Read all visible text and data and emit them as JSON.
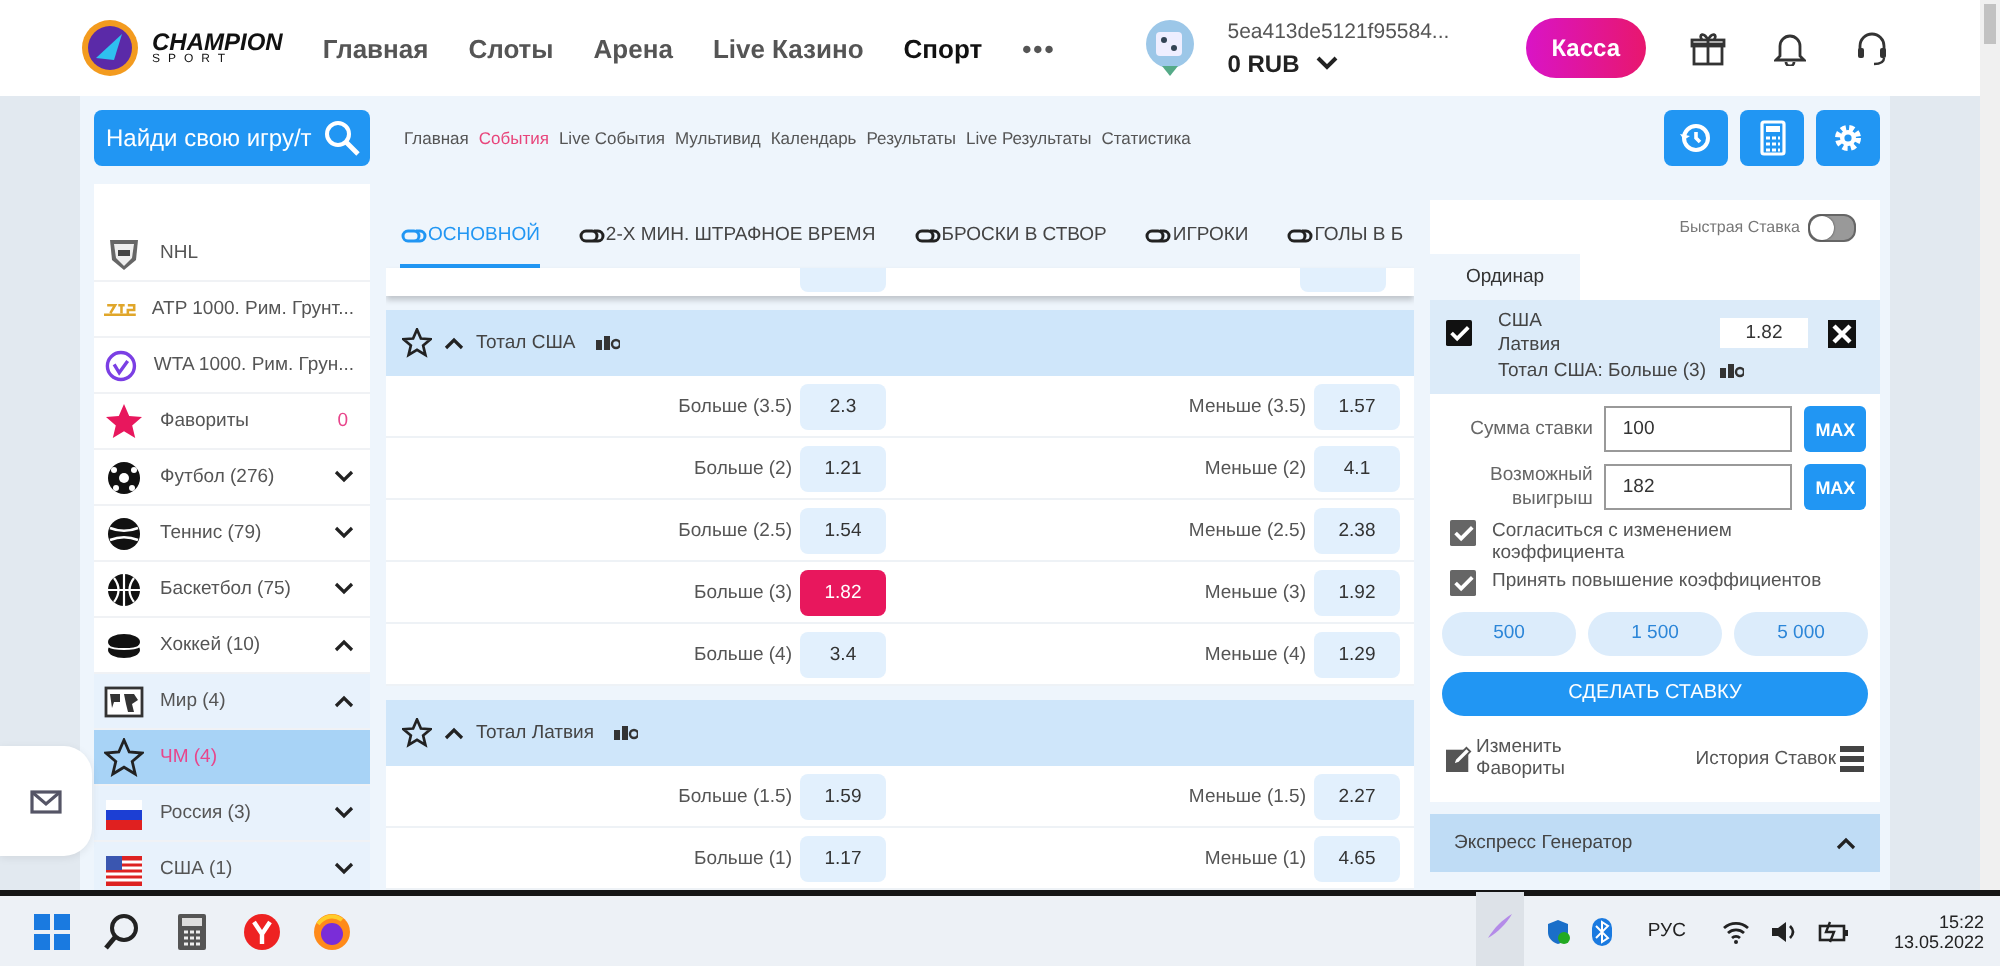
{
  "header": {
    "logo": {
      "title": "CHAMPION",
      "subtitle": "SPORT"
    },
    "nav": [
      {
        "label": "Главная",
        "selected": false
      },
      {
        "label": "Слоты",
        "selected": false
      },
      {
        "label": "Арена",
        "selected": false
      },
      {
        "label": "Live Казино",
        "selected": false
      },
      {
        "label": "Спорт",
        "selected": true
      }
    ],
    "more": "•••",
    "account": {
      "user_id": "5ea413de5121f95584...",
      "balance": "0 RUB"
    },
    "cashier_button": "Касса"
  },
  "subbar": {
    "search": {
      "placeholder": "Найди свою игру/т"
    },
    "breadcrumbs": [
      {
        "label": "Главная",
        "selected": false
      },
      {
        "label": "События",
        "selected": true
      },
      {
        "label": "Live События",
        "selected": false
      },
      {
        "label": "Мультивид",
        "selected": false
      },
      {
        "label": "Календарь",
        "selected": false
      },
      {
        "label": "Результаты",
        "selected": false
      },
      {
        "label": "Live Результаты",
        "selected": false
      },
      {
        "label": "Статистика",
        "selected": false
      }
    ]
  },
  "sidebar": {
    "items": [
      {
        "kind": "nhl",
        "label": "NHL",
        "selected": false
      },
      {
        "kind": "atp",
        "label": "ATP 1000. Рим. Грунт...",
        "selected": false
      },
      {
        "kind": "wta",
        "label": "WTA 1000. Рим. Грун...",
        "selected": false
      },
      {
        "kind": "favorites",
        "label": "Фавориты",
        "count": "0",
        "selected": false
      },
      {
        "kind": "football",
        "label": "Футбол (276)",
        "selected": false,
        "expanded": false
      },
      {
        "kind": "tennis",
        "label": "Теннис (79)",
        "selected": false,
        "expanded": false
      },
      {
        "kind": "basketball",
        "label": "Баскетбол (75)",
        "selected": false,
        "expanded": false
      },
      {
        "kind": "hockey",
        "label": "Хоккей (10)",
        "selected": false,
        "expanded": true,
        "children": [
          {
            "kind": "world",
            "label": "Мир (4)",
            "selected": false,
            "expanded": true,
            "children": [
              {
                "kind": "tournament",
                "label": "ЧМ (4)",
                "selected": true
              }
            ]
          },
          {
            "kind": "flag-ru",
            "label": "Россия (3)",
            "selected": false,
            "expanded": false
          },
          {
            "kind": "flag-us",
            "label": "США (1)",
            "selected": false,
            "expanded": false
          }
        ]
      }
    ]
  },
  "market_tabs": [
    {
      "label": "ОСНОВНОЙ",
      "selected": true
    },
    {
      "label": "2-Х МИН. ШТРАФНОЕ ВРЕМЯ",
      "selected": false
    },
    {
      "label": "БРОСКИ В СТВОР",
      "selected": false
    },
    {
      "label": "ИГРОКИ",
      "selected": false
    },
    {
      "label": "ГОЛЫ В Б",
      "selected": false
    }
  ],
  "markets": [
    {
      "title": "Тотал США",
      "favorite": false,
      "expanded": true,
      "rows": [
        {
          "left": {
            "label": "Больше (3.5)",
            "odds": "2.3",
            "selected": false
          },
          "right": {
            "label": "Меньше (3.5)",
            "odds": "1.57",
            "selected": false
          }
        },
        {
          "left": {
            "label": "Больше (2)",
            "odds": "1.21",
            "selected": false
          },
          "right": {
            "label": "Меньше (2)",
            "odds": "4.1",
            "selected": false
          }
        },
        {
          "left": {
            "label": "Больше (2.5)",
            "odds": "1.54",
            "selected": false
          },
          "right": {
            "label": "Меньше (2.5)",
            "odds": "2.38",
            "selected": false
          }
        },
        {
          "left": {
            "label": "Больше (3)",
            "odds": "1.82",
            "selected": true
          },
          "right": {
            "label": "Меньше (3)",
            "odds": "1.92",
            "selected": false
          }
        },
        {
          "left": {
            "label": "Больше (4)",
            "odds": "3.4",
            "selected": false
          },
          "right": {
            "label": "Меньше (4)",
            "odds": "1.29",
            "selected": false
          }
        }
      ]
    },
    {
      "title": "Тотал Латвия",
      "favorite": false,
      "expanded": true,
      "rows": [
        {
          "left": {
            "label": "Больше (1.5)",
            "odds": "1.59",
            "selected": false
          },
          "right": {
            "label": "Меньше (1.5)",
            "odds": "2.27",
            "selected": false
          }
        },
        {
          "left": {
            "label": "Больше (1)",
            "odds": "1.17",
            "selected": false
          },
          "right": {
            "label": "Меньше (1)",
            "odds": "4.65",
            "selected": false
          }
        }
      ]
    }
  ],
  "bet_slip": {
    "quick_bet": {
      "label": "Быстрая Ставка",
      "on": false
    },
    "tabs": [
      {
        "label": "Ординар",
        "selected": true
      }
    ],
    "bet": {
      "team_1": "США",
      "team_2": "Латвия",
      "odds": "1.82",
      "market": "Тотал США: Больше (3)",
      "checked": true
    },
    "stake": {
      "label": "Сумма ставки",
      "value": "100",
      "max": "MAX"
    },
    "win": {
      "label": "Возможный выигрыш",
      "value": "182",
      "max": "MAX"
    },
    "options": [
      {
        "label": "Согласиться с изменением коэффициента",
        "checked": true
      },
      {
        "label": "Принять повышение коэффициентов",
        "checked": true
      }
    ],
    "quick_amounts": [
      "500",
      "1 500",
      "5 000"
    ],
    "submit": "СДЕЛАТЬ СТАВКУ",
    "edit_favorites": "Изменить Фавориты",
    "history": "История Ставок"
  },
  "express_generator": {
    "title": "Экспресс Генератор",
    "expanded": true
  },
  "taskbar": {
    "language": "РУС",
    "time": "15:22",
    "date": "13.05.2022"
  }
}
